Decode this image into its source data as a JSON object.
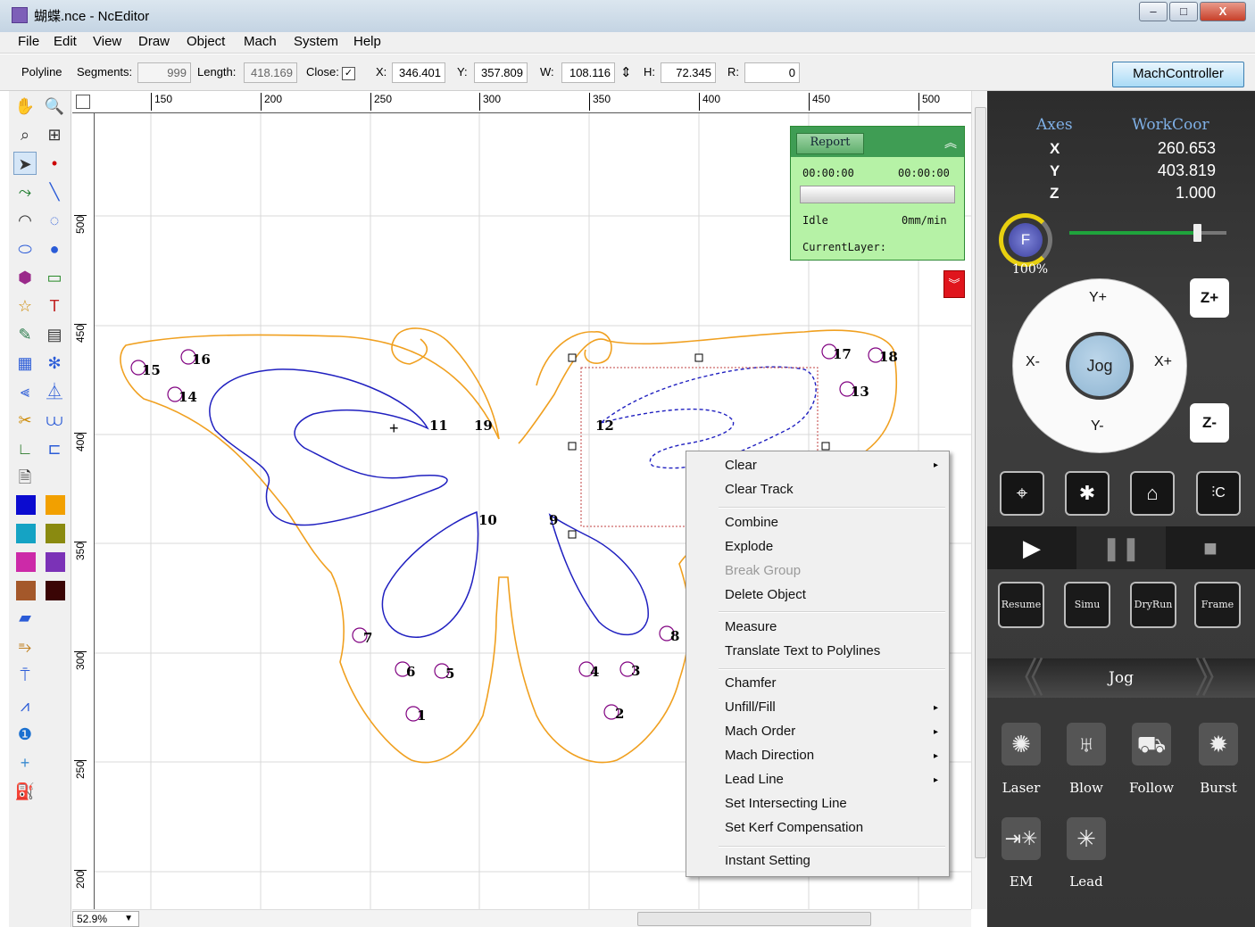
{
  "window": {
    "title": "蝴蝶.nce - NcEditor",
    "min": "–",
    "max": "□",
    "close": "X"
  },
  "menu": [
    "File",
    "Edit",
    "View",
    "Draw",
    "Object",
    "Mach",
    "System",
    "Help"
  ],
  "props": {
    "type": "Polyline",
    "segments_label": "Segments:",
    "segments": "999",
    "length_label": "Length:",
    "length": "418.169",
    "close_label": "Close:",
    "close_checked": "✓",
    "x_label": "X:",
    "x": "346.401",
    "y_label": "Y:",
    "y": "357.809",
    "w_label": "W:",
    "w": "108.116",
    "h_label": "H:",
    "h": "72.345",
    "r_label": "R:",
    "r": "0",
    "lock_icon": "⇕"
  },
  "machcontroller": "MachController",
  "ruler": {
    "h": [
      "150",
      "200",
      "250",
      "300",
      "350",
      "400",
      "450",
      "500"
    ],
    "v": [
      "500",
      "450",
      "400",
      "350",
      "300",
      "250",
      "200"
    ]
  },
  "zoom": "52.9%",
  "labels": [
    "11",
    "19",
    "12",
    "10",
    "9",
    "15",
    "16",
    "14",
    "17",
    "18",
    "13",
    "7",
    "6",
    "5",
    "4",
    "3",
    "8",
    "1",
    "2"
  ],
  "report": {
    "button": "Report",
    "time_start": "00:00:00",
    "time_end": "00:00:00",
    "status": "Idle",
    "speed": "0mm/min",
    "layer": "CurrentLayer:"
  },
  "context_menu": [
    {
      "label": "Clear",
      "arrow": "▸"
    },
    {
      "label": "Clear Track"
    },
    {
      "label": "Combine"
    },
    {
      "label": "Explode"
    },
    {
      "label": "Break Group",
      "disabled": true
    },
    {
      "label": "Delete Object"
    },
    {
      "label": "Measure"
    },
    {
      "label": "Translate Text to Polylines"
    },
    {
      "label": "Chamfer"
    },
    {
      "label": "Unfill/Fill",
      "arrow": "▸"
    },
    {
      "label": "Mach Order",
      "arrow": "▸"
    },
    {
      "label": "Mach Direction",
      "arrow": "▸"
    },
    {
      "label": "Lead Line",
      "arrow": "▸"
    },
    {
      "label": "Set Intersecting Line"
    },
    {
      "label": "Set Kerf Compensation"
    },
    {
      "label": "Instant Setting"
    }
  ],
  "controller": {
    "axes_header": "Axes",
    "coor_header": "WorkCoor",
    "axes": [
      {
        "name": "X",
        "value": "260.653"
      },
      {
        "name": "Y",
        "value": "403.819"
      },
      {
        "name": "Z",
        "value": "1.000"
      }
    ],
    "feed_label": "F",
    "feed_pct": "100%",
    "feed_level": 0.83,
    "dpad": {
      "up": "Y+",
      "down": "Y-",
      "left": "X-",
      "right": "X+",
      "center": "Jog"
    },
    "z_up": "Z+",
    "z_down": "Z-",
    "mode_buttons": [
      "Resume",
      "Simu",
      "DryRun",
      "Frame"
    ],
    "jog_label": "Jog",
    "functions": [
      {
        "label": "Laser",
        "icon": "laser-icon"
      },
      {
        "label": "Blow",
        "icon": "blow-icon"
      },
      {
        "label": "Follow",
        "icon": "follow-icon"
      },
      {
        "label": "Burst",
        "icon": "burst-icon"
      },
      {
        "label": "EM",
        "icon": "em-icon"
      },
      {
        "label": "Lead",
        "icon": "lead-icon"
      }
    ]
  },
  "colors": {
    "accent_green": "#3f9d54",
    "panel_green": "#b6f2a6",
    "outline_orange": "#f0a020",
    "path_blue": "#2020c0",
    "alert_red": "#e0151d"
  }
}
